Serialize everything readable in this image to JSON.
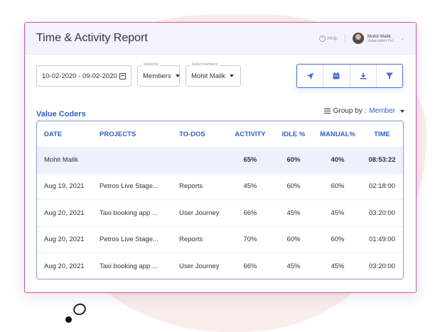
{
  "report": {
    "title": "Time & Activity Report",
    "help_label": "Help",
    "user": {
      "name": "Mohit Malik",
      "org": "Valuecoders Pvt..."
    }
  },
  "filters": {
    "date_range": "10-02-2020 - 09-02-2020",
    "select_by_label": "Select by",
    "select_by_value": "Members",
    "select_members_label": "Select members",
    "select_members_value": "Mohit Malik"
  },
  "actions": [
    "send-icon",
    "calendar-icon",
    "download-icon",
    "filter-icon"
  ],
  "section": {
    "org_name": "Value Coders",
    "group_by_label": "Group by :",
    "group_by_value": "Member"
  },
  "table": {
    "columns": [
      "DATE",
      "PROJECTS",
      "TO-DOS",
      "ACTIVITY",
      "IDLE %",
      "MANUAL%",
      "TIME"
    ],
    "summary": {
      "name": "Mohit Malik",
      "activity": "65%",
      "idle": "60%",
      "manual": "40%",
      "time": "08:53:22"
    },
    "rows": [
      {
        "date": "Aug 19, 2021",
        "project": "Petros Live Stage...",
        "todo": "Reports",
        "activity": "45%",
        "idle": "60%",
        "manual": "60%",
        "time": "02:18:00"
      },
      {
        "date": "Aug 20, 2021",
        "project": "Taxi booking app ...",
        "todo": "User Journey",
        "activity": "66%",
        "idle": "45%",
        "manual": "45%",
        "time": "03:20:00"
      },
      {
        "date": "Aug 20, 2021",
        "project": "Petros Live Stage...",
        "todo": "Reports",
        "activity": "70%",
        "idle": "60%",
        "manual": "60%",
        "time": "01:49:00"
      },
      {
        "date": "Aug 20, 2021",
        "project": "Taxi booking app ...",
        "todo": "User Journey",
        "activity": "66%",
        "idle": "45%",
        "manual": "45%",
        "time": "03:20:00"
      }
    ]
  },
  "colors": {
    "accent": "#2f5fc9",
    "border_pink": "#d94fa7",
    "header_bg": "#f3f2fd"
  }
}
